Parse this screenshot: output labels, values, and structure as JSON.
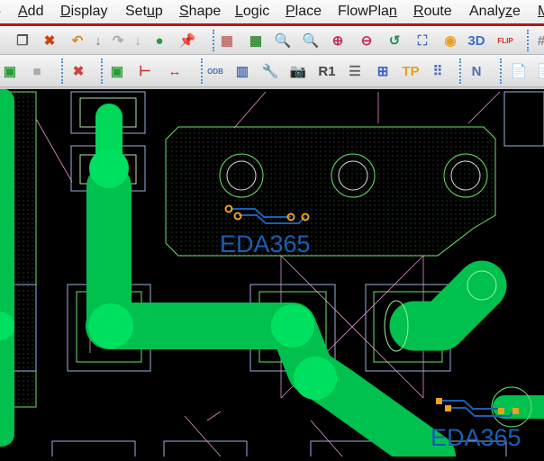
{
  "menubar": {
    "items": [
      {
        "label": "Add",
        "u": "A",
        "rest": "dd"
      },
      {
        "label": "Display",
        "u": "D",
        "rest": "isplay"
      },
      {
        "label": "Setup",
        "pre": "Set",
        "u": "u",
        "rest": "p"
      },
      {
        "label": "Shape",
        "u": "S",
        "rest": "hape"
      },
      {
        "label": "Logic",
        "u": "L",
        "rest": "ogic"
      },
      {
        "label": "Place",
        "u": "P",
        "rest": "lace"
      },
      {
        "label": "FlowPlan",
        "pre": "FlowPla",
        "u": "n",
        "rest": ""
      },
      {
        "label": "Route",
        "u": "R",
        "rest": "oute"
      },
      {
        "label": "Analyze",
        "pre": "Analy",
        "u": "z",
        "rest": "e"
      },
      {
        "label": "M",
        "u": "M",
        "rest": ""
      }
    ]
  },
  "toolbar1": {
    "icons": [
      {
        "name": "copy-icon",
        "glyph": "❐",
        "color": "#555"
      },
      {
        "name": "delete-icon",
        "glyph": "✖",
        "color": "#d04010"
      },
      {
        "name": "undo-icon",
        "glyph": "↶",
        "color": "#e08a20"
      },
      {
        "name": "undo-list-icon",
        "glyph": "↓",
        "color": "#777"
      },
      {
        "name": "redo-icon",
        "glyph": "↷",
        "color": "#aaa"
      },
      {
        "name": "redo-list-icon",
        "glyph": "↓",
        "color": "#aaa"
      },
      {
        "name": "ratsnest-icon",
        "glyph": "●",
        "color": "#2a9a3a"
      },
      {
        "name": "pin-icon",
        "glyph": "📌",
        "color": "#2a9a3a"
      },
      {
        "name": "unrats-icon",
        "glyph": "▦",
        "color": "#c07070"
      },
      {
        "name": "rats-all-icon",
        "glyph": "▦",
        "color": "#3a8a3a"
      },
      {
        "name": "zoom-points-icon",
        "glyph": "🔍",
        "color": "#4a70b0"
      },
      {
        "name": "zoom-fit-icon",
        "glyph": "🔍",
        "color": "#c04080"
      },
      {
        "name": "zoom-in-icon",
        "glyph": "⊕",
        "color": "#c03060"
      },
      {
        "name": "zoom-out-icon",
        "glyph": "⊖",
        "color": "#c03060"
      },
      {
        "name": "zoom-previous-icon",
        "glyph": "↺",
        "color": "#2a8a5a"
      },
      {
        "name": "zoom-world-icon",
        "glyph": "⛶",
        "color": "#4a70b0"
      },
      {
        "name": "redraw-icon",
        "glyph": "◉",
        "color": "#e8a020"
      },
      {
        "name": "3d-view-icon",
        "glyph": "3D",
        "color": "#3a70d0"
      },
      {
        "name": "flip-icon",
        "glyph": "FLIP",
        "color": "#c03020"
      },
      {
        "name": "grid-icon",
        "glyph": "#",
        "color": "#888"
      }
    ]
  },
  "toolbar2": {
    "icons": [
      {
        "name": "color-icon",
        "glyph": "▣",
        "color": "#2a9a3a"
      },
      {
        "name": "shadow-icon",
        "glyph": "■",
        "color": "#aaa"
      },
      {
        "name": "unassign-color-icon",
        "glyph": "✖",
        "color": "#d04040"
      },
      {
        "name": "assign-color-icon",
        "glyph": "▣",
        "color": "#2a9a3a"
      },
      {
        "name": "dimension-icon",
        "glyph": "⊢",
        "color": "#c03030"
      },
      {
        "name": "measure-icon",
        "glyph": "↔",
        "color": "#c03030"
      },
      {
        "name": "odb-export-icon",
        "glyph": "ODB",
        "color": "#4a70b0"
      },
      {
        "name": "library-icon",
        "glyph": "▥",
        "color": "#4a70b0"
      },
      {
        "name": "tools-icon",
        "glyph": "🔧",
        "color": "#666"
      },
      {
        "name": "camera-icon",
        "glyph": "📷",
        "color": "#666"
      },
      {
        "name": "rename-refdes-icon",
        "glyph": "R1",
        "color": "#444"
      },
      {
        "name": "report-icon",
        "glyph": "☰",
        "color": "#666"
      },
      {
        "name": "placement-grid-icon",
        "glyph": "⊞",
        "color": "#3a60c0"
      },
      {
        "name": "testpoint-icon",
        "glyph": "TP",
        "color": "#e0a020"
      },
      {
        "name": "array-icon",
        "glyph": "⠿",
        "color": "#4a70b0"
      },
      {
        "name": "route-icon",
        "glyph": "N",
        "color": "#4a70b0"
      },
      {
        "name": "document-icon",
        "glyph": "📄",
        "color": "#c04040"
      },
      {
        "name": "document2-icon",
        "glyph": "📄",
        "color": "#888"
      }
    ]
  },
  "canvas": {
    "logo_text": "EDA365",
    "colors": {
      "track": "#00c04e",
      "pad": "#00e060",
      "shape_outline": "#6ee06e",
      "logo": "#1a5fb4",
      "via": "#f0a020"
    }
  }
}
